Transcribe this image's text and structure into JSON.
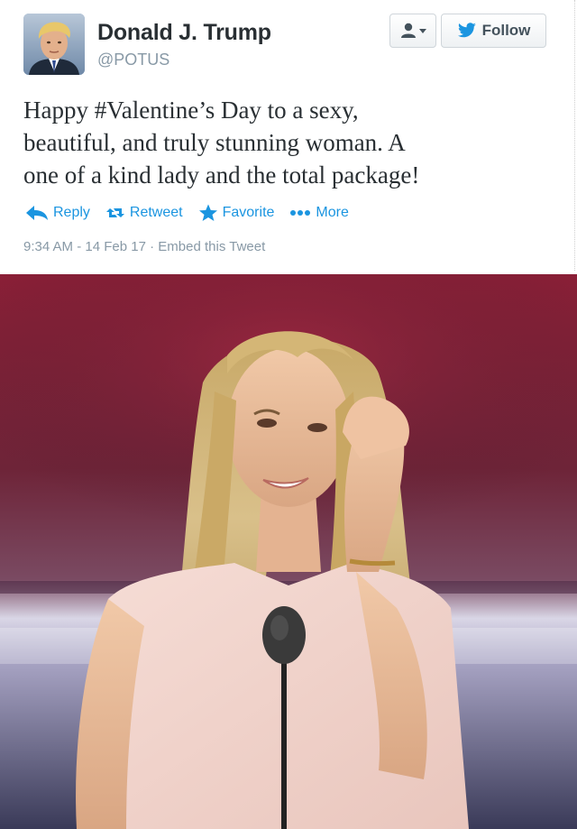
{
  "user": {
    "display_name": "Donald J. Trump",
    "screen_name": "@POTUS"
  },
  "header": {
    "follow_label": "Follow",
    "user_dropdown_icon": "user-dropdown-icon",
    "follow_icon": "twitter-bird-icon"
  },
  "tweet": {
    "text_line1": "Happy #Valentine’s Day to a sexy,",
    "text_line2": "beautiful, and truly stunning woman. A",
    "text_line3": "one of a kind lady and the total package!"
  },
  "actions": {
    "reply_label": "Reply",
    "retweet_label": "Retweet",
    "favorite_label": "Favorite",
    "more_label": "More"
  },
  "meta": {
    "time": "9:34 AM",
    "separator1": " - ",
    "date": "14 Feb 17",
    "separator2": " · ",
    "embed_label": "Embed this Tweet"
  },
  "colors": {
    "link": "#1b95e0",
    "name": "#292f33",
    "muted": "#8899a6"
  }
}
